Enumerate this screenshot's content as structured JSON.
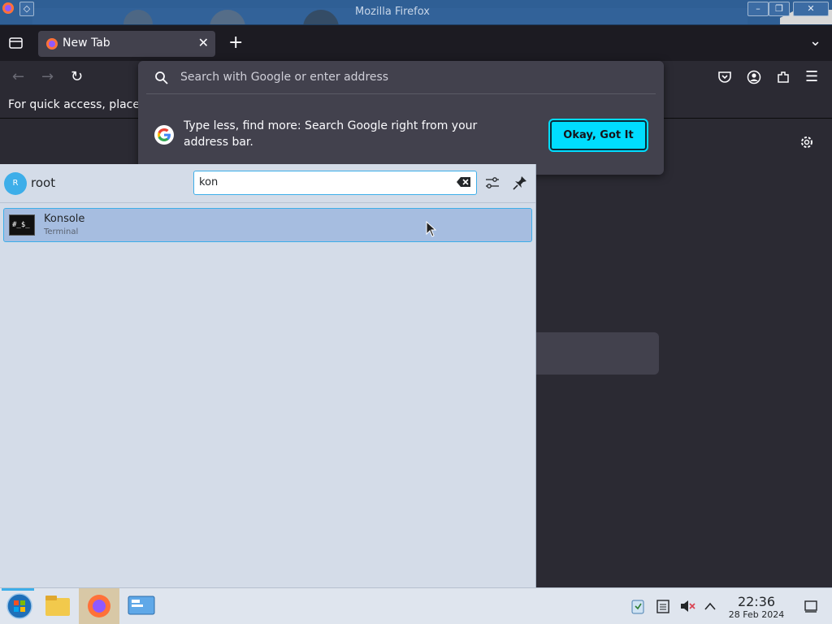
{
  "window": {
    "title": "Mozilla Firefox",
    "controls": {
      "minimize": "–",
      "maximize": "❐",
      "close": "✕"
    }
  },
  "tabs": {
    "active_label": "New Tab",
    "close_glyph": "✕",
    "new_tab_glyph": "+",
    "list_all_glyph": "⌄"
  },
  "nav": {
    "back": "←",
    "forward": "→",
    "reload": "↻",
    "menu": "☰"
  },
  "bookmarks_bar": {
    "text": "For quick access, place y"
  },
  "url_popup": {
    "placeholder": "Search with Google or enter address",
    "tip_text": "Type less, find more: Search Google right from your address bar.",
    "ok_button": "Okay, Got It"
  },
  "launcher": {
    "user_initial": "R",
    "username": "root",
    "search_value": "kon",
    "results": [
      {
        "name": "Konsole",
        "description": "Terminal",
        "icon": "terminal-icon"
      }
    ]
  },
  "taskbar": {
    "time": "22:36",
    "date": "28 Feb 2024",
    "apps": [
      "start-menu-icon",
      "file-manager-icon",
      "firefox-icon",
      "system-settings-icon"
    ],
    "tray": [
      "clipboard-icon",
      "notes-icon",
      "volume-muted-icon",
      "tray-expand-icon",
      "show-desktop-icon"
    ]
  },
  "colors": {
    "accent": "#00ddff",
    "kde_blue": "#3daee9",
    "firefox_dark": "#2b2a33",
    "launcher_bg": "#d4dce8"
  }
}
